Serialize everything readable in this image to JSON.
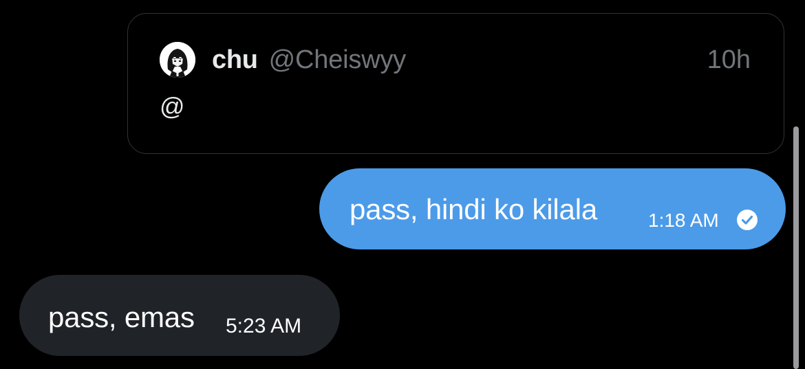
{
  "quote": {
    "author_name": "chu",
    "author_handle": "@Cheiswyy",
    "time": "10h",
    "body": "@",
    "avatar_icon": "anime-avatar-icon"
  },
  "messages": [
    {
      "direction": "sent",
      "text": "pass, hindi ko kilala",
      "time": "1:18 AM",
      "status_icon": "read-check-icon",
      "bubble_color": "#4c9be8"
    },
    {
      "direction": "received",
      "text": "pass, emas",
      "time": "5:23 AM",
      "bubble_color": "#202327"
    }
  ],
  "colors": {
    "background": "#000000",
    "text_primary": "#e7e9ea",
    "text_secondary": "#71767b",
    "card_border": "#2f3336"
  }
}
